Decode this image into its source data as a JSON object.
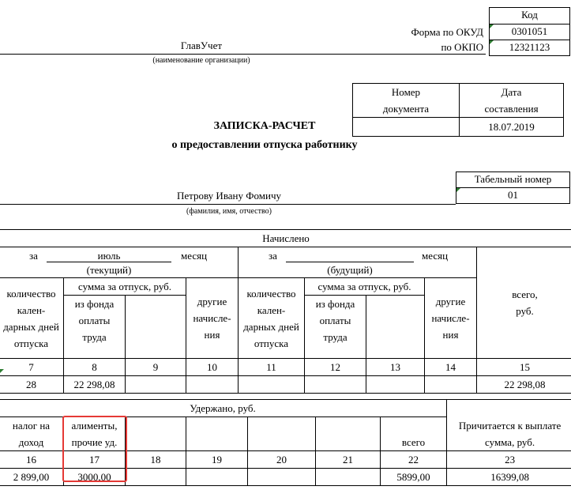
{
  "org": {
    "name": "ГлавУчет",
    "caption": "(наименование организации)"
  },
  "codes": {
    "header": "Код",
    "okud_label": "Форма по ОКУД",
    "okud_value": "0301051",
    "okpo_label": "по ОКПО",
    "okpo_value": "12321123"
  },
  "doc": {
    "number_h1": "Номер",
    "number_h2": "документа",
    "date_h1": "Дата",
    "date_h2": "составления",
    "number_value": "",
    "date_value": "18.07.2019"
  },
  "title": {
    "line1": "ЗАПИСКА-РАСЧЕТ",
    "line2": "о предоставлении отпуска работнику"
  },
  "tab": {
    "header": "Табельный номер",
    "value": "01"
  },
  "employee": {
    "name": "Петрову Ивану Фомичу",
    "caption": "(фамилия, имя, отчество)"
  },
  "accrued": {
    "header": "Начислено",
    "za": "за",
    "month_word": "месяц",
    "current_month": "июль",
    "current_caption": "(текущий)",
    "next_month": "",
    "next_caption": "(будущий)",
    "days_label": [
      "количество",
      "кален-",
      "дарных дней",
      "отпуска"
    ],
    "sum_label": "сумма за отпуск, руб.",
    "fund_label": [
      "из фонда",
      "оплаты",
      "труда"
    ],
    "other_label": [
      "другие",
      "начисле-",
      "ния"
    ],
    "total_label": [
      "всего,",
      "руб."
    ],
    "col_numbers": [
      "7",
      "8",
      "9",
      "10",
      "11",
      "12",
      "13",
      "14",
      "15"
    ],
    "values": [
      "28",
      "22 298,08",
      "",
      "",
      "",
      "",
      "",
      "",
      "22 298,08"
    ]
  },
  "withheld": {
    "header": "Удержано, руб.",
    "tax_label": [
      "налог на",
      "доход"
    ],
    "alimony_label": [
      "алименты,",
      "прочие уд."
    ],
    "total_label": "всего",
    "payable_label": [
      "Причитается к выплате",
      "сумма, руб."
    ],
    "col_numbers": [
      "16",
      "17",
      "18",
      "19",
      "20",
      "21",
      "22",
      "23"
    ],
    "values": [
      "2 899,00",
      "3000,00",
      "",
      "",
      "",
      "",
      "5899,00",
      "16399,08"
    ]
  }
}
